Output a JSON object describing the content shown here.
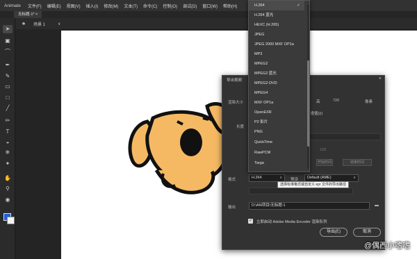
{
  "app": {
    "name": "Animate"
  },
  "menu": [
    "文件(F)",
    "编辑(E)",
    "视图(V)",
    "插入(I)",
    "修改(M)",
    "文本(T)",
    "命令(C)",
    "控制(O)",
    "调试(D)",
    "窗口(W)",
    "帮助(H)"
  ],
  "doc_tab": "无标题-1*  ×",
  "scene": {
    "label": "场景 1"
  },
  "tools": [
    "select-arrow",
    "subselect",
    "lasso",
    "pen",
    "brush",
    "eraser",
    "rectangle",
    "line",
    "pencil",
    "text",
    "paint-bucket",
    "eyedropper",
    "pin",
    "hand",
    "zoom",
    "eye",
    "camera"
  ],
  "colors": {
    "stroke": "#1d5fd6",
    "fill": "#f2f2f2",
    "dog_body": "#f5b964",
    "outline": "#111111"
  },
  "dialog": {
    "title": "导出视频",
    "close": "×",
    "render_size_label": "渲染大小",
    "height_label": "高",
    "height_value": "720",
    "pixels_label": "像素",
    "partial_text": "a 遵循)(i)",
    "range_label": "长度",
    "format_label": "格式",
    "format_value": "H.264",
    "preset_label": "预设",
    "preset_value": "Default (AME)",
    "output_label": "输出",
    "output_value": "D:\\AN项目\\无标题-1",
    "checkbox_label": "立即启动 Adobe Media Encoder 渲染队列",
    "export_button": "导出(E)",
    "cancel_button": "取消",
    "mini_buttons": [
      "",
      "开始时间",
      "结束时间"
    ],
    "num_field": "120"
  },
  "tooltip": "选择标准格式或自定义 epr 文件的导出路径",
  "dropdown": {
    "items": [
      "H.264",
      "H.264 蓝光",
      "HEVC (H.265)",
      "JPEG",
      "JPEG 2000 MXF OP1a",
      "MP3",
      "MPEG2",
      "MPEG2 蓝光",
      "MPEG2-DVD",
      "MPEG4",
      "MXF OP1a",
      "OpenEXR",
      "P2 影片",
      "PNG",
      "QuickTime",
      "RawPCM",
      "Targa"
    ],
    "selected_index": 0,
    "check_mark": "✓"
  },
  "watermark": "@偶西小嗜嗜"
}
